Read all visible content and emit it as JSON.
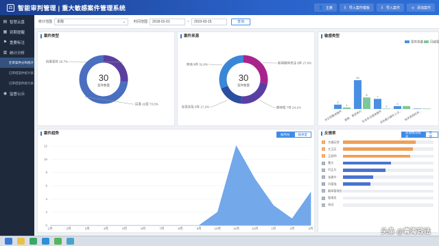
{
  "header": {
    "title": "智能审判管理 | 重大敏感案件管理系统",
    "actions": [
      {
        "icon": "user-icon",
        "label": "主席"
      },
      {
        "icon": "import-icon",
        "label": "导入案件模板"
      },
      {
        "icon": "import-icon",
        "label": "导入案件"
      },
      {
        "icon": "add-icon",
        "label": "添加案件"
      }
    ]
  },
  "sidebar": {
    "items": [
      {
        "icon": "case-icon",
        "label": "智慧云盘"
      },
      {
        "icon": "doc-icon",
        "label": "到期提醒"
      },
      {
        "icon": "flag-icon",
        "label": "重要标注"
      },
      {
        "icon": "chart-icon",
        "label": "统计分析"
      }
    ],
    "subitems": [
      {
        "label": "在审案件分布统计",
        "active": true
      },
      {
        "label": "已审结案件统计表",
        "active": false
      },
      {
        "label": "已审结案件统计表",
        "active": false
      }
    ],
    "bottom": {
      "icon": "bell-icon",
      "label": "监督公示"
    }
  },
  "filters": {
    "range_label": "统计范围",
    "range_value": "本院",
    "time_label": "时间范围",
    "start_date": "2018-01-01",
    "end_date": "2019-03-15",
    "query_button": "查询"
  },
  "case_type": {
    "title": "案件类型",
    "center_value": "30",
    "center_label": "案件数量",
    "chart_data": {
      "type": "pie",
      "slices": [
        {
          "label": "刑事案件 26.7%",
          "value": 8,
          "color": "#5b3f9e"
        },
        {
          "label": "民事 22案 73.3%",
          "value": 22,
          "color": "#4a6fc0"
        }
      ]
    }
  },
  "case_source": {
    "title": "案件来源",
    "center_value": "30",
    "center_label": "案件数量",
    "chart_data": {
      "type": "pie",
      "slices": [
        {
          "label": "新闻媒体关注 8件 27.6%",
          "value": 27.6,
          "color": "#a8238c"
        },
        {
          "label": "群体性 7件 24.1%",
          "value": 24.1,
          "color": "#5a3fa3"
        },
        {
          "label": "办案涉及 5件 17.2%",
          "value": 17.2,
          "color": "#2b4fa0"
        },
        {
          "label": "其他 9件 31.0%",
          "value": 31.0,
          "color": "#3a87d8"
        }
      ]
    }
  },
  "sensitive_type": {
    "title": "敏感类型",
    "legend": [
      "案件总量",
      "已结案"
    ],
    "chart_data": {
      "type": "bar",
      "categories": [
        "涉众型集资案件",
        "腐败、黑恶势力",
        "社会关注度高案件",
        "涉及重大案件上访...",
        "有关党政机关..."
      ],
      "series": [
        {
          "name": "案件总量",
          "values": [
            3,
            20,
            7,
            2,
            0
          ],
          "color": "#4a90e2"
        },
        {
          "name": "已结案",
          "values": [
            1,
            8,
            0,
            2,
            0
          ],
          "color": "#7cc79c"
        }
      ],
      "value_labels": [
        "3",
        "1",
        "20",
        "8",
        "7",
        "2",
        "0"
      ],
      "ylim": [
        0,
        20
      ]
    }
  },
  "trend": {
    "title": "案件趋势",
    "tabs": [
      "按月份",
      "按季度"
    ],
    "chart_data": {
      "type": "area",
      "x": [
        "1月",
        "2月",
        "3月",
        "4月",
        "5月",
        "6月",
        "7月",
        "8月",
        "9月",
        "10月",
        "11月",
        "12月",
        "1月",
        "2月",
        "3月"
      ],
      "values": [
        0,
        0,
        0,
        0,
        0,
        0,
        0,
        0,
        0,
        2,
        12,
        7,
        3,
        1,
        5
      ],
      "yticks": [
        "0",
        "2",
        "4",
        "6",
        "8",
        "10",
        "12"
      ],
      "ylim": [
        0,
        12
      ],
      "color": "#5b9ae8"
    }
  },
  "ranking": {
    "title": "反馈率",
    "tabs": [
      "反馈情况排名",
      "反馈"
    ],
    "rows": [
      {
        "rank": "1",
        "name": "大唐区院",
        "value": 0.8,
        "color": "#f0a05a"
      },
      {
        "rank": "2",
        "name": "大王区",
        "value": 0.77,
        "color": "#f0a05a"
      },
      {
        "rank": "3",
        "name": "王辰明",
        "value": 0.74,
        "color": "#f0a05a"
      },
      {
        "rank": "4",
        "name": "董方",
        "value": 0.53,
        "color": "#4a72d0"
      },
      {
        "rank": "5",
        "name": "闫正方",
        "value": 0.47,
        "color": "#4a72d0"
      },
      {
        "rank": "6",
        "name": "张建华",
        "value": 0.33,
        "color": "#4a72d0"
      },
      {
        "rank": "7",
        "name": "闫德强",
        "value": 0.3,
        "color": "#4a72d0"
      },
      {
        "rank": "8",
        "name": "最高管理员",
        "value": 0.0,
        "color": "#4a72d0"
      },
      {
        "rank": "9",
        "name": "管理员",
        "value": 0.0,
        "color": "#4a72d0"
      },
      {
        "rank": "10",
        "name": "测试",
        "value": 0.0,
        "color": "#4a72d0"
      }
    ]
  },
  "watermark": "头条 @青海政法"
}
